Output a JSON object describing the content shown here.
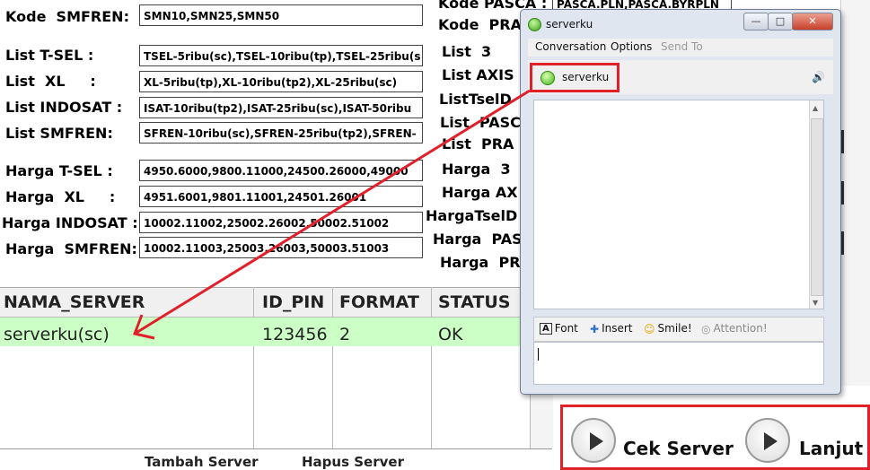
{
  "form": {
    "rows": [
      {
        "label": "Kode  SMFREN:",
        "value": "SMN10,SMN25,SMN50"
      },
      {
        "label": "List T-SEL :",
        "value": "TSEL-5ribu(sc),TSEL-10ribu(tp),TSEL-25ribu(s"
      },
      {
        "label": "List  XL     :",
        "value": "XL-5ribu(tp),XL-10ribu(tp2),XL-25ribu(sc)"
      },
      {
        "label": "List INDOSAT :",
        "value": "ISAT-10ribu(tp2),ISAT-25ribu(sc),ISAT-50ribu"
      },
      {
        "label": "List SMFREN:",
        "value": "SFREN-10ribu(sc),SFREN-25ribu(tp2),SFREN-"
      },
      {
        "label": "Harga T-SEL :",
        "value": "4950.6000,9800.11000,24500.26000,49000"
      },
      {
        "label": "Harga  XL     :",
        "value": "4951.6001,9801.11001,24501.26001"
      },
      {
        "label": "Harga INDOSAT :",
        "value": "10002.11002,25002.26002,50002.51002"
      },
      {
        "label": "Harga  SMFREN:",
        "value": "10002.11003,25003.26003,50003.51003"
      }
    ]
  },
  "right_form": {
    "top_label": "Kode PASCA :",
    "top_value": "PASCA.PLN,PASCA.BYRPLN",
    "labels": [
      "Kode  PRA",
      "List  3",
      "List AXIS",
      "ListTselD",
      "List  PASCA",
      "List  PRA",
      "Harga  3",
      "Harga AX",
      "HargaTselD",
      "Harga  PAS",
      "Harga  PR"
    ]
  },
  "grid": {
    "columns": [
      "NAMA_SERVER",
      "ID_PIN",
      "FORMAT",
      "STATUS"
    ],
    "rows": [
      [
        "serverku(sc)",
        "123456",
        "2",
        "OK"
      ]
    ]
  },
  "bottom": {
    "add_label": "Tambah Server",
    "delete_label": "Hapus Server"
  },
  "actions": {
    "check_label": "Cek Server",
    "next_label": "Lanjut"
  },
  "messenger": {
    "title": "serverku",
    "menus": [
      "Conversation",
      "Options",
      "Send To"
    ],
    "contact": "serverku",
    "tools": {
      "font": "Font",
      "insert": "Insert",
      "smile": "Smile!",
      "attention": "Attention!"
    },
    "window_buttons": {
      "minimize": "—",
      "maximize": "□",
      "close": "✕"
    }
  },
  "colors": {
    "highlight_row": "#ccffc6",
    "annotation_red": "#e0202a",
    "status_online": "#46b317"
  }
}
